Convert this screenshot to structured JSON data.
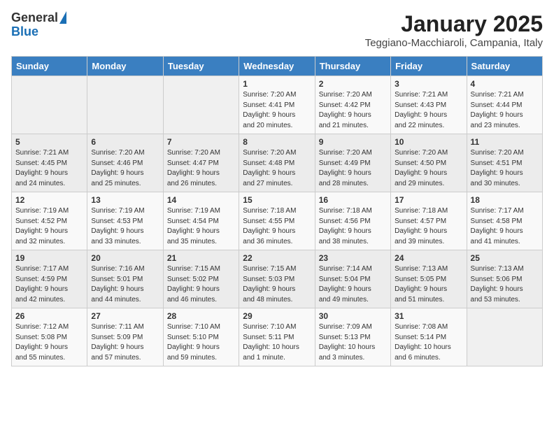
{
  "header": {
    "logo_general": "General",
    "logo_blue": "Blue",
    "month": "January 2025",
    "location": "Teggiano-Macchiaroli, Campania, Italy"
  },
  "weekdays": [
    "Sunday",
    "Monday",
    "Tuesday",
    "Wednesday",
    "Thursday",
    "Friday",
    "Saturday"
  ],
  "weeks": [
    [
      {
        "day": "",
        "info": ""
      },
      {
        "day": "",
        "info": ""
      },
      {
        "day": "",
        "info": ""
      },
      {
        "day": "1",
        "info": "Sunrise: 7:20 AM\nSunset: 4:41 PM\nDaylight: 9 hours\nand 20 minutes."
      },
      {
        "day": "2",
        "info": "Sunrise: 7:20 AM\nSunset: 4:42 PM\nDaylight: 9 hours\nand 21 minutes."
      },
      {
        "day": "3",
        "info": "Sunrise: 7:21 AM\nSunset: 4:43 PM\nDaylight: 9 hours\nand 22 minutes."
      },
      {
        "day": "4",
        "info": "Sunrise: 7:21 AM\nSunset: 4:44 PM\nDaylight: 9 hours\nand 23 minutes."
      }
    ],
    [
      {
        "day": "5",
        "info": "Sunrise: 7:21 AM\nSunset: 4:45 PM\nDaylight: 9 hours\nand 24 minutes."
      },
      {
        "day": "6",
        "info": "Sunrise: 7:20 AM\nSunset: 4:46 PM\nDaylight: 9 hours\nand 25 minutes."
      },
      {
        "day": "7",
        "info": "Sunrise: 7:20 AM\nSunset: 4:47 PM\nDaylight: 9 hours\nand 26 minutes."
      },
      {
        "day": "8",
        "info": "Sunrise: 7:20 AM\nSunset: 4:48 PM\nDaylight: 9 hours\nand 27 minutes."
      },
      {
        "day": "9",
        "info": "Sunrise: 7:20 AM\nSunset: 4:49 PM\nDaylight: 9 hours\nand 28 minutes."
      },
      {
        "day": "10",
        "info": "Sunrise: 7:20 AM\nSunset: 4:50 PM\nDaylight: 9 hours\nand 29 minutes."
      },
      {
        "day": "11",
        "info": "Sunrise: 7:20 AM\nSunset: 4:51 PM\nDaylight: 9 hours\nand 30 minutes."
      }
    ],
    [
      {
        "day": "12",
        "info": "Sunrise: 7:19 AM\nSunset: 4:52 PM\nDaylight: 9 hours\nand 32 minutes."
      },
      {
        "day": "13",
        "info": "Sunrise: 7:19 AM\nSunset: 4:53 PM\nDaylight: 9 hours\nand 33 minutes."
      },
      {
        "day": "14",
        "info": "Sunrise: 7:19 AM\nSunset: 4:54 PM\nDaylight: 9 hours\nand 35 minutes."
      },
      {
        "day": "15",
        "info": "Sunrise: 7:18 AM\nSunset: 4:55 PM\nDaylight: 9 hours\nand 36 minutes."
      },
      {
        "day": "16",
        "info": "Sunrise: 7:18 AM\nSunset: 4:56 PM\nDaylight: 9 hours\nand 38 minutes."
      },
      {
        "day": "17",
        "info": "Sunrise: 7:18 AM\nSunset: 4:57 PM\nDaylight: 9 hours\nand 39 minutes."
      },
      {
        "day": "18",
        "info": "Sunrise: 7:17 AM\nSunset: 4:58 PM\nDaylight: 9 hours\nand 41 minutes."
      }
    ],
    [
      {
        "day": "19",
        "info": "Sunrise: 7:17 AM\nSunset: 4:59 PM\nDaylight: 9 hours\nand 42 minutes."
      },
      {
        "day": "20",
        "info": "Sunrise: 7:16 AM\nSunset: 5:01 PM\nDaylight: 9 hours\nand 44 minutes."
      },
      {
        "day": "21",
        "info": "Sunrise: 7:15 AM\nSunset: 5:02 PM\nDaylight: 9 hours\nand 46 minutes."
      },
      {
        "day": "22",
        "info": "Sunrise: 7:15 AM\nSunset: 5:03 PM\nDaylight: 9 hours\nand 48 minutes."
      },
      {
        "day": "23",
        "info": "Sunrise: 7:14 AM\nSunset: 5:04 PM\nDaylight: 9 hours\nand 49 minutes."
      },
      {
        "day": "24",
        "info": "Sunrise: 7:13 AM\nSunset: 5:05 PM\nDaylight: 9 hours\nand 51 minutes."
      },
      {
        "day": "25",
        "info": "Sunrise: 7:13 AM\nSunset: 5:06 PM\nDaylight: 9 hours\nand 53 minutes."
      }
    ],
    [
      {
        "day": "26",
        "info": "Sunrise: 7:12 AM\nSunset: 5:08 PM\nDaylight: 9 hours\nand 55 minutes."
      },
      {
        "day": "27",
        "info": "Sunrise: 7:11 AM\nSunset: 5:09 PM\nDaylight: 9 hours\nand 57 minutes."
      },
      {
        "day": "28",
        "info": "Sunrise: 7:10 AM\nSunset: 5:10 PM\nDaylight: 9 hours\nand 59 minutes."
      },
      {
        "day": "29",
        "info": "Sunrise: 7:10 AM\nSunset: 5:11 PM\nDaylight: 10 hours\nand 1 minute."
      },
      {
        "day": "30",
        "info": "Sunrise: 7:09 AM\nSunset: 5:13 PM\nDaylight: 10 hours\nand 3 minutes."
      },
      {
        "day": "31",
        "info": "Sunrise: 7:08 AM\nSunset: 5:14 PM\nDaylight: 10 hours\nand 6 minutes."
      },
      {
        "day": "",
        "info": ""
      }
    ]
  ]
}
